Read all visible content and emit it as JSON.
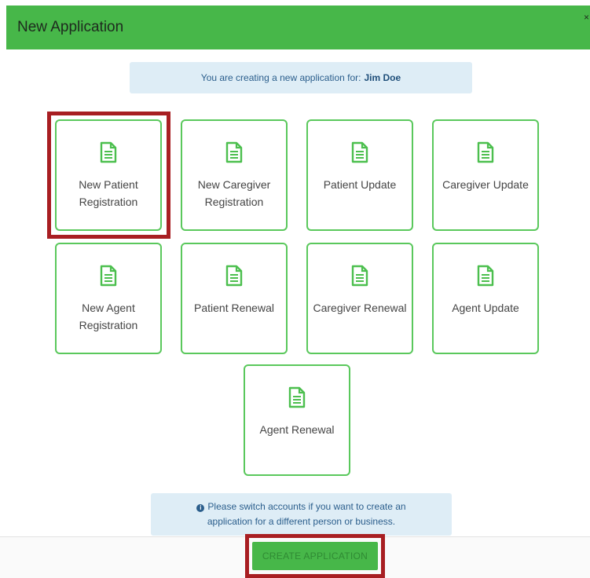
{
  "dialog": {
    "title": "New Application",
    "close_glyph": "×"
  },
  "info": {
    "prefix": "You are creating a new application for:",
    "name": "Jim Doe"
  },
  "tiles": [
    {
      "label": "New Patient Registration",
      "icon": "document-icon"
    },
    {
      "label": "New Caregiver Registration",
      "icon": "document-icon"
    },
    {
      "label": "Patient Update",
      "icon": "document-icon"
    },
    {
      "label": "Caregiver Update",
      "icon": "document-icon"
    },
    {
      "label": "New Agent Registration",
      "icon": "document-icon"
    },
    {
      "label": "Patient Renewal",
      "icon": "document-icon"
    },
    {
      "label": "Caregiver Renewal",
      "icon": "document-icon"
    },
    {
      "label": "Agent Update",
      "icon": "document-icon"
    },
    {
      "label": "Agent Renewal",
      "icon": "document-icon"
    }
  ],
  "notice": {
    "icon": "info-circle-icon",
    "line1": "Please switch accounts if you want to create an",
    "line2": "application for a different person or business."
  },
  "footer": {
    "create_label": "CREATE APPLICATION"
  },
  "colors": {
    "brand_green": "#47b749",
    "tile_border": "#5ac85c",
    "highlight_red": "#a81e22",
    "info_bg": "#deedf6"
  }
}
